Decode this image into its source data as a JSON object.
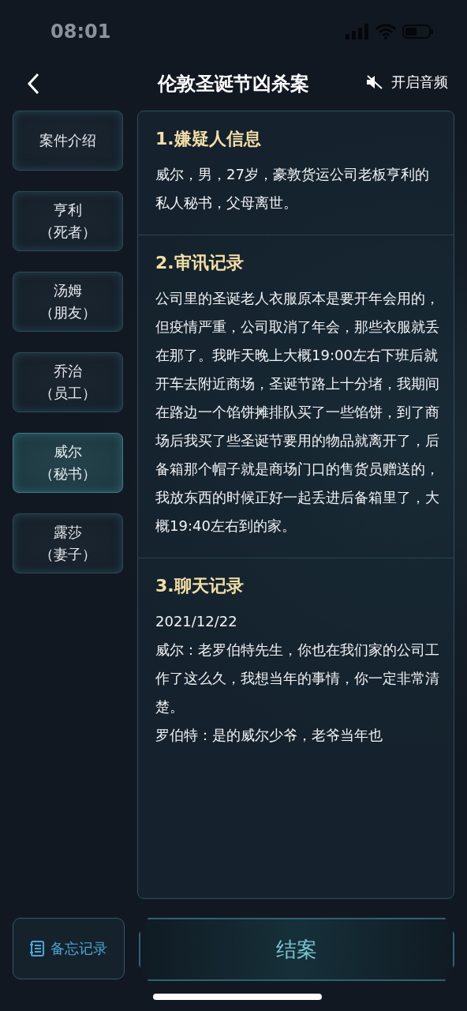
{
  "status_bar": {
    "time": "08:01"
  },
  "header": {
    "title": "伦敦圣诞节凶杀案",
    "audio_label": "开启音频",
    "muted": true
  },
  "sidebar": {
    "items": [
      {
        "lines": [
          "案件介绍"
        ],
        "selected": false
      },
      {
        "lines": [
          "亨利",
          "（死者）"
        ],
        "selected": false
      },
      {
        "lines": [
          "汤姆",
          "（朋友）"
        ],
        "selected": false
      },
      {
        "lines": [
          "乔治",
          "（员工）"
        ],
        "selected": false
      },
      {
        "lines": [
          "威尔",
          "（秘书）"
        ],
        "selected": true
      },
      {
        "lines": [
          "露莎",
          "（妻子）"
        ],
        "selected": false
      }
    ]
  },
  "sections": [
    {
      "heading": "1.嫌疑人信息",
      "paragraphs": [
        "威尔，男，27岁，豪敦货运公司老板亨利的私人秘书，父母离世。"
      ]
    },
    {
      "heading": "2.审讯记录",
      "paragraphs": [
        "公司里的圣诞老人衣服原本是要开年会用的，但疫情严重，公司取消了年会，那些衣服就丢在那了。我昨天晚上大概19:00左右下班后就开车去附近商场，圣诞节路上十分堵，我期间在路边一个馅饼摊排队买了一些馅饼，到了商场后我买了些圣诞节要用的物品就离开了，后备箱那个帽子就是商场门口的售货员赠送的，我放东西的时候正好一起丢进后备箱里了，大概19:40左右到的家。"
      ]
    },
    {
      "heading": "3.聊天记录",
      "paragraphs": [
        "2021/12/22",
        "威尔：老罗伯特先生，你也在我们家的公司工作了这么久，我想当年的事情，你一定非常清楚。",
        "罗伯特：是的威尔少爷，老爷当年也"
      ]
    }
  ],
  "footer": {
    "memo_label": "备忘记录",
    "close_case_label": "结案"
  }
}
